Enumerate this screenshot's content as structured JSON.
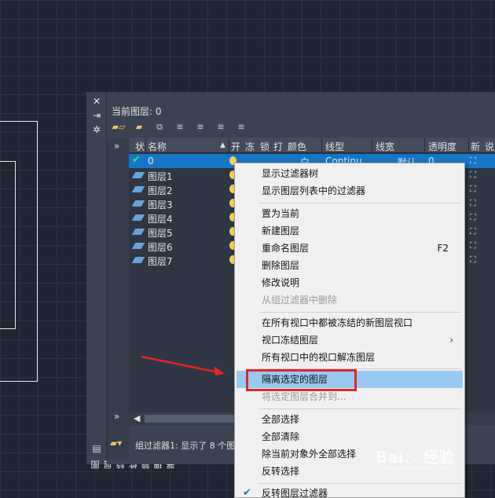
{
  "palette": {
    "title": "图层特性管理器",
    "current_layer_label": "当前图层: 0",
    "side_buttons": [
      "✕",
      "⇥",
      "✲"
    ],
    "columns": {
      "status": "状",
      "name": "名称",
      "on": "开",
      "freeze": "冻",
      "lock": "锁",
      "plot": "打",
      "color": "颜色",
      "linetype": "线型",
      "lineweight": "线宽",
      "transparency": "透明度",
      "new": "新",
      "desc": "说"
    },
    "layers": [
      {
        "name": "0",
        "current": true
      },
      {
        "name": "图层1"
      },
      {
        "name": "图层2"
      },
      {
        "name": "图层3"
      },
      {
        "name": "图层4"
      },
      {
        "name": "图层5"
      },
      {
        "name": "图层6"
      },
      {
        "name": "图层7"
      }
    ],
    "row0_color_text": "白",
    "row0_linetype_text": "Continu",
    "row0_lineweight_text": "—— 默认",
    "row0_transparency_text": "0",
    "status_text": "组过滤器1: 显示了 8 个图"
  },
  "context_menu": {
    "items": [
      {
        "label": "显示过滤器树"
      },
      {
        "label": "显示图层列表中的过滤器"
      },
      {
        "label": "置为当前"
      },
      {
        "label": "新建图层"
      },
      {
        "label": "重命名图层",
        "shortcut": "F2"
      },
      {
        "label": "删除图层"
      },
      {
        "label": "修改说明"
      },
      {
        "label": "从组过滤器中删除",
        "disabled": true
      },
      {
        "label": "在所有视口中都被冻结的新图层视口"
      },
      {
        "label": "视口冻结图层",
        "submenu": true
      },
      {
        "label": "所有视口中的视口解冻图层"
      },
      {
        "label": "隔离选定的图层",
        "highlighted": true
      },
      {
        "label": "将选定图层合并到...",
        "disabled": true
      },
      {
        "label": "全部选择"
      },
      {
        "label": "全部清除"
      },
      {
        "label": "除当前对象外全部选择"
      },
      {
        "label": "反转选择"
      },
      {
        "label": "反转图层过滤器",
        "checked": true
      }
    ]
  },
  "watermark": {
    "brand": "Bai♨ 经验",
    "sub": "jingyan.baidu.com"
  },
  "colors": {
    "canvas_bg": "#1f2633",
    "selection": "#1476c5",
    "menu_hover": "#99c9f0",
    "annotation_red": "#e0262a"
  }
}
